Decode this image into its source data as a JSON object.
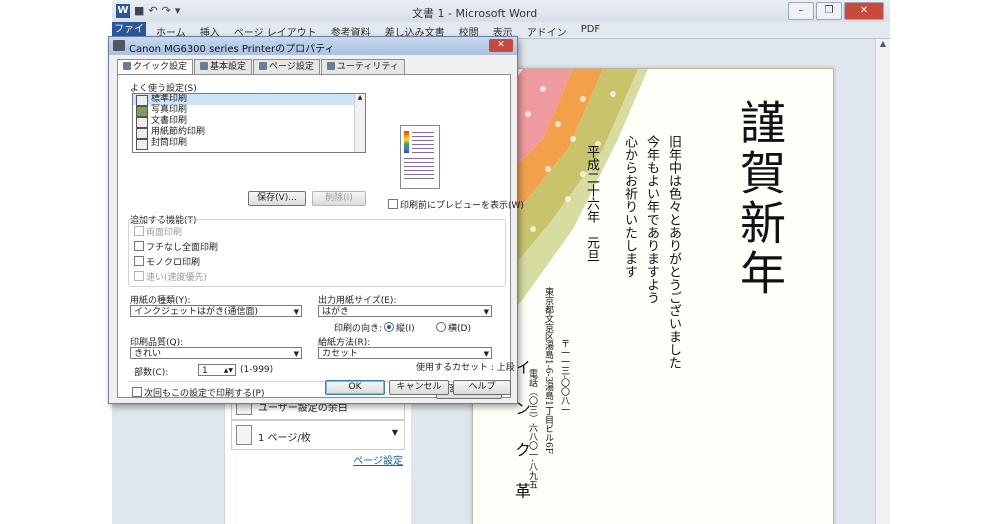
{
  "word": {
    "title": "文書 1 - Microsoft Word",
    "app_icon": "W",
    "qat_icons": [
      "save-icon",
      "undo-icon",
      "redo-icon",
      "dropdown-icon"
    ],
    "file_tab": "ファイル",
    "tabs": [
      "ホーム",
      "挿入",
      "ページ レイアウト",
      "参考資料",
      "差し込み文書",
      "校閲",
      "表示",
      "アドイン",
      "PDF"
    ],
    "window_buttons": [
      "minimize-icon",
      "restore-icon",
      "close-icon"
    ]
  },
  "print_panel": {
    "row1": "ユーザー設定の余白",
    "row2": "1 ページ/枚",
    "page_setup_link": "ページ設定"
  },
  "card": {
    "heading": "謹賀新年",
    "greeting": [
      "旧年中は色々とありがとうございました",
      "今年もよい年でありますよう",
      "心からお祈りいたします"
    ],
    "date": "平成二十六年　元旦",
    "address": [
      "〒一一三‐〇〇八一",
      "東京都文京区湯島1‐6‐3湯島1丁目ビル6F",
      "電話（〇三）六八〇一‐八九五"
    ],
    "company": "イ ン ク 革 命"
  },
  "dialog": {
    "title": "Canon MG6300 series Printerのプロパティ",
    "tabs": [
      "クイック設定",
      "基本設定",
      "ページ設定",
      "ユーティリティ"
    ],
    "favorites_label": "よく使う設定(S)",
    "favorites": [
      "標準印刷",
      "写真印刷",
      "文書印刷",
      "用紙節約印刷",
      "封筒印刷"
    ],
    "save_button": "保存(V)...",
    "delete_button": "削除(I)",
    "preview_checkbox": "印刷前にプレビューを表示(W)",
    "features_label": "追加する機能(T)",
    "features": [
      {
        "label": "両面印刷",
        "enabled": false
      },
      {
        "label": "フチなし全面印刷",
        "enabled": true
      },
      {
        "label": "モノクロ印刷",
        "enabled": true
      },
      {
        "label": "速い(速度優先)",
        "enabled": false
      }
    ],
    "media_type_label": "用紙の種類(Y):",
    "media_type_value": "インクジェットはがき(通信面)",
    "paper_size_label": "出力用紙サイズ(E):",
    "paper_size_value": "はがき",
    "orientation_label": "印刷の向き:",
    "orientation_portrait": "縦(I)",
    "orientation_landscape": "横(D)",
    "quality_label": "印刷品質(Q):",
    "quality_value": "きれい",
    "paper_source_label": "給紙方法(R):",
    "paper_source_value": "カセット",
    "copies_label": "部数(C):",
    "copies_value": "1",
    "copies_range": "(1-999)",
    "cassette_label": "使用するカセット : 上段",
    "always_print_label": "次回もこの設定で印刷する(P)",
    "defaults_button": "標準に戻す(F)",
    "ok_button": "OK",
    "cancel_button": "キャンセル",
    "help_button": "ヘルプ"
  },
  "colors": {
    "word_blue": "#2b579a",
    "pink": "#ee9a9f",
    "orange": "#f2a14a",
    "olive": "#c9c46c",
    "green": "#d7dca0"
  }
}
